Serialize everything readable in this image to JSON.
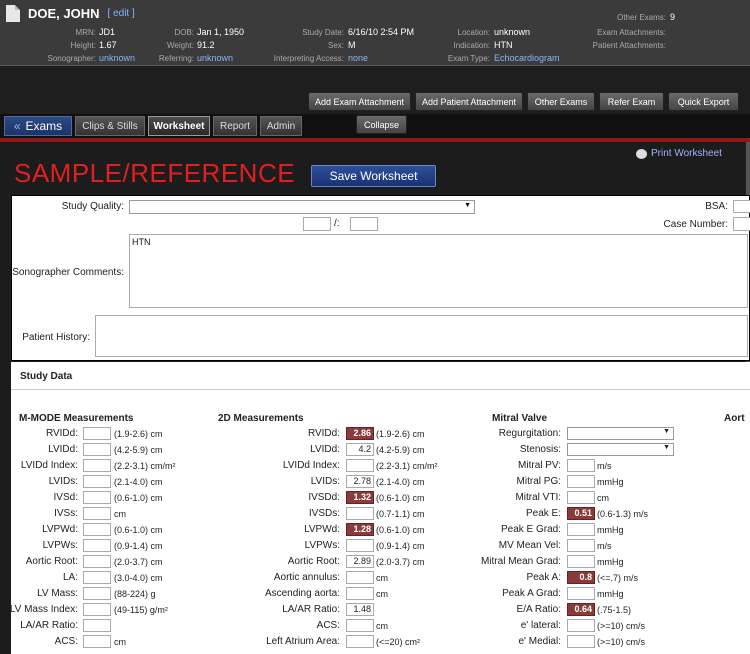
{
  "patient": {
    "name": "DOE, JOHN",
    "edit": "[ edit ]",
    "mrn_label": "MRN:",
    "mrn": "JD1",
    "height_label": "Height:",
    "height": "1.67",
    "sonographer_label": "Sonographer:",
    "sonographer": "unknown",
    "dob_label": "DOB:",
    "dob": "Jan 1, 1950",
    "weight_label": "Weight:",
    "weight": "91.2",
    "referring_label": "Referring:",
    "referring": "unknown",
    "studydate_label": "Study Date:",
    "studydate": "6/16/10 2:54 PM",
    "sex_label": "Sex:",
    "sex": "M",
    "interp_label": "Interpreting Access:",
    "interp": "none",
    "location_label": "Location:",
    "location": "unknown",
    "indication_label": "Indication:",
    "indication": "HTN",
    "examtype_label": "Exam Type:",
    "examtype": "Echocardiogram",
    "otherexams_label": "Other Exams:",
    "otherexams": "9",
    "examatt_label": "Exam Attachments:",
    "patatt_label": "Patient Attachments:"
  },
  "toolbar": {
    "add_exam_attachment": "Add Exam Attachment",
    "add_patient_attachment": "Add Patient Attachment",
    "other_exams": "Other Exams",
    "refer_exam": "Refer Exam",
    "quick_export": "Quick Export"
  },
  "tabs": {
    "exams": "Exams",
    "clips": "Clips & Stills",
    "worksheet": "Worksheet",
    "report": "Report",
    "admin": "Admin",
    "collapse": "Collapse"
  },
  "worksheet": {
    "banner": "SAMPLE/REFERENCE",
    "save": "Save Worksheet",
    "print": "Print Worksheet",
    "study_quality_label": "Study Quality:",
    "bsa_label": "BSA:",
    "case_number_label": "Case Number:",
    "slash": "/:",
    "sonographer_comments_label": "Sonographer Comments:",
    "sonographer_comments_value": "HTN",
    "patient_history_label": "Patient History:"
  },
  "study_data": {
    "title": "Study Data",
    "mmode_title": "M-MODE Measurements",
    "twod_title": "2D Measurements",
    "mitral_title": "Mitral Valve",
    "aort_title": "Aort",
    "mmode": [
      {
        "label": "RVIDd:",
        "value": "",
        "range": "(1.9-2.6) cm"
      },
      {
        "label": "LVIDd:",
        "value": "",
        "range": "(4.2-5.9) cm"
      },
      {
        "label": "LVIDd Index:",
        "value": "",
        "range": "(2.2-3.1) cm/m²"
      },
      {
        "label": "LVIDs:",
        "value": "",
        "range": "(2.1-4.0) cm"
      },
      {
        "label": "IVSd:",
        "value": "",
        "range": "(0.6-1.0) cm"
      },
      {
        "label": "IVSs:",
        "value": "",
        "range": "cm"
      },
      {
        "label": "LVPWd:",
        "value": "",
        "range": "(0.6-1.0) cm"
      },
      {
        "label": "LVPWs:",
        "value": "",
        "range": "(0.9-1.4) cm"
      },
      {
        "label": "Aortic Root:",
        "value": "",
        "range": "(2.0-3.7) cm"
      },
      {
        "label": "LA:",
        "value": "",
        "range": "(3.0-4.0) cm"
      },
      {
        "label": "LV Mass:",
        "value": "",
        "range": "(88-224) g"
      },
      {
        "label": "LV Mass Index:",
        "value": "",
        "range": "(49-115) g/m²"
      },
      {
        "label": "LA/AR Ratio:",
        "value": "",
        "range": ""
      },
      {
        "label": "ACS:",
        "value": "",
        "range": "cm"
      }
    ],
    "twod": [
      {
        "label": "RVIDd:",
        "value": "2.86",
        "abn": true,
        "range": "(1.9-2.6) cm"
      },
      {
        "label": "LVIDd:",
        "value": "4.2",
        "abn": false,
        "range": "(4.2-5.9) cm"
      },
      {
        "label": "LVIDd Index:",
        "value": "",
        "abn": false,
        "range": "(2.2-3.1) cm/m²"
      },
      {
        "label": "LVIDs:",
        "value": "2.78",
        "abn": false,
        "range": "(2.1-4.0) cm"
      },
      {
        "label": "IVSDd:",
        "value": "1.32",
        "abn": true,
        "range": "(0.6-1.0) cm"
      },
      {
        "label": "IVSDs:",
        "value": "",
        "abn": false,
        "range": "(0.7-1.1) cm"
      },
      {
        "label": "LVPWd:",
        "value": "1.28",
        "abn": true,
        "range": "(0.6-1.0) cm"
      },
      {
        "label": "LVPWs:",
        "value": "",
        "abn": false,
        "range": "(0.9-1.4) cm"
      },
      {
        "label": "Aortic Root:",
        "value": "2.89",
        "abn": false,
        "range": "(2.0-3.7) cm"
      },
      {
        "label": "Aortic annulus:",
        "value": "",
        "abn": false,
        "range": "cm"
      },
      {
        "label": "Ascending aorta:",
        "value": "",
        "abn": false,
        "range": "cm"
      },
      {
        "label": "LA/AR Ratio:",
        "value": "1.48",
        "abn": false,
        "range": ""
      },
      {
        "label": "ACS:",
        "value": "",
        "abn": false,
        "range": "cm"
      },
      {
        "label": "Left Atrium Area:",
        "value": "",
        "abn": false,
        "range": "(<=20) cm²"
      }
    ],
    "mitral": [
      {
        "label": "Regurgitation:",
        "type": "select"
      },
      {
        "label": "Stenosis:",
        "type": "select"
      },
      {
        "label": "Mitral PV:",
        "value": "",
        "abn": false,
        "range": "m/s"
      },
      {
        "label": "Mitral PG:",
        "value": "",
        "abn": false,
        "range": "mmHg"
      },
      {
        "label": "Mitral VTI:",
        "value": "",
        "abn": false,
        "range": "cm"
      },
      {
        "label": "Peak E:",
        "value": "0.51",
        "abn": true,
        "range": "(0.6-1.3) m/s"
      },
      {
        "label": "Peak E Grad:",
        "value": "",
        "abn": false,
        "range": "mmHg"
      },
      {
        "label": "MV Mean Vel:",
        "value": "",
        "abn": false,
        "range": "m/s"
      },
      {
        "label": "Mitral Mean Grad:",
        "value": "",
        "abn": false,
        "range": "mmHg"
      },
      {
        "label": "Peak A:",
        "value": "0.8",
        "abn": true,
        "range": "(<=.7) m/s"
      },
      {
        "label": "Peak A Grad:",
        "value": "",
        "abn": false,
        "range": "mmHg"
      },
      {
        "label": "E/A Ratio:",
        "value": "0.64",
        "abn": true,
        "range": "(.75-1.5)"
      },
      {
        "label": "e' lateral:",
        "value": "",
        "abn": false,
        "range": "(>=10) cm/s"
      },
      {
        "label": "e' Medial:",
        "value": "",
        "abn": false,
        "range": "(>=10) cm/s"
      }
    ]
  }
}
